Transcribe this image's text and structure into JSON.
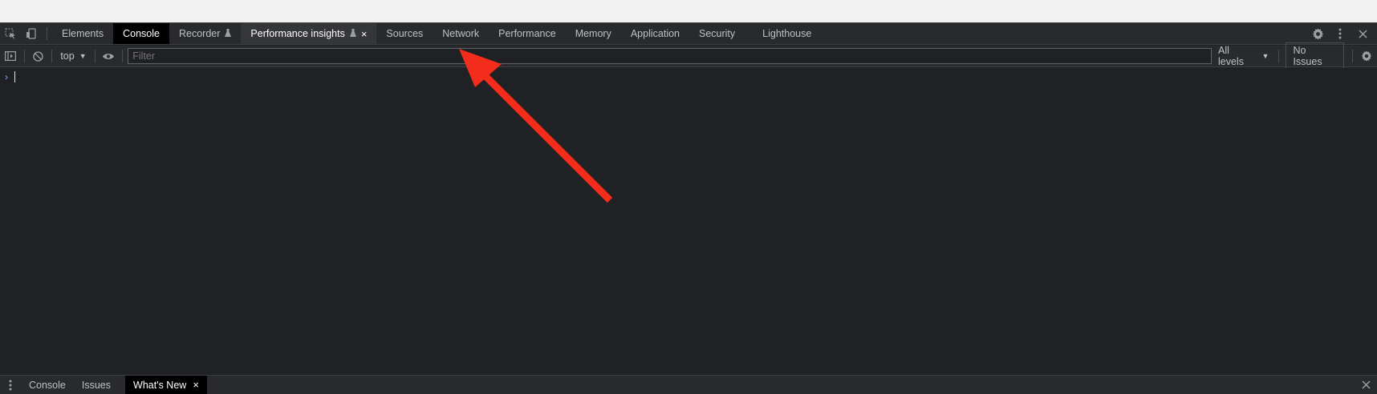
{
  "tabs": [
    {
      "label": "Elements",
      "state": "normal"
    },
    {
      "label": "Console",
      "state": "active"
    },
    {
      "label": "Recorder",
      "state": "normal",
      "icon": "flask-icon"
    },
    {
      "label": "Performance insights",
      "state": "hovered",
      "icon": "flask-icon",
      "close": "×"
    },
    {
      "label": "Sources",
      "state": "normal"
    },
    {
      "label": "Network",
      "state": "normal"
    },
    {
      "label": "Performance",
      "state": "normal"
    },
    {
      "label": "Memory",
      "state": "normal"
    },
    {
      "label": "Application",
      "state": "normal"
    },
    {
      "label": "Security",
      "state": "normal"
    },
    {
      "label": "Lighthouse",
      "state": "normal"
    }
  ],
  "toolbar": {
    "context": "top",
    "filter_placeholder": "Filter",
    "levels": "All levels",
    "issues": "No Issues"
  },
  "console": {
    "prompt_symbol": "›"
  },
  "drawer": {
    "tabs": [
      {
        "label": "Console",
        "active": false
      },
      {
        "label": "Issues",
        "active": false
      },
      {
        "label": "What's New",
        "active": true,
        "close": "×"
      }
    ]
  },
  "icons": {
    "inspect": "inspect-element-icon",
    "device": "device-toolbar-icon",
    "settings": "gear-icon",
    "more": "more-vertical-icon",
    "close": "close-icon",
    "sidebar": "sidebar-toggle-icon",
    "clear": "clear-console-icon",
    "eye": "live-expression-eye-icon"
  },
  "colors": {
    "annotation_arrow": "#f42c1b",
    "accent_prompt": "#7cacf8"
  }
}
